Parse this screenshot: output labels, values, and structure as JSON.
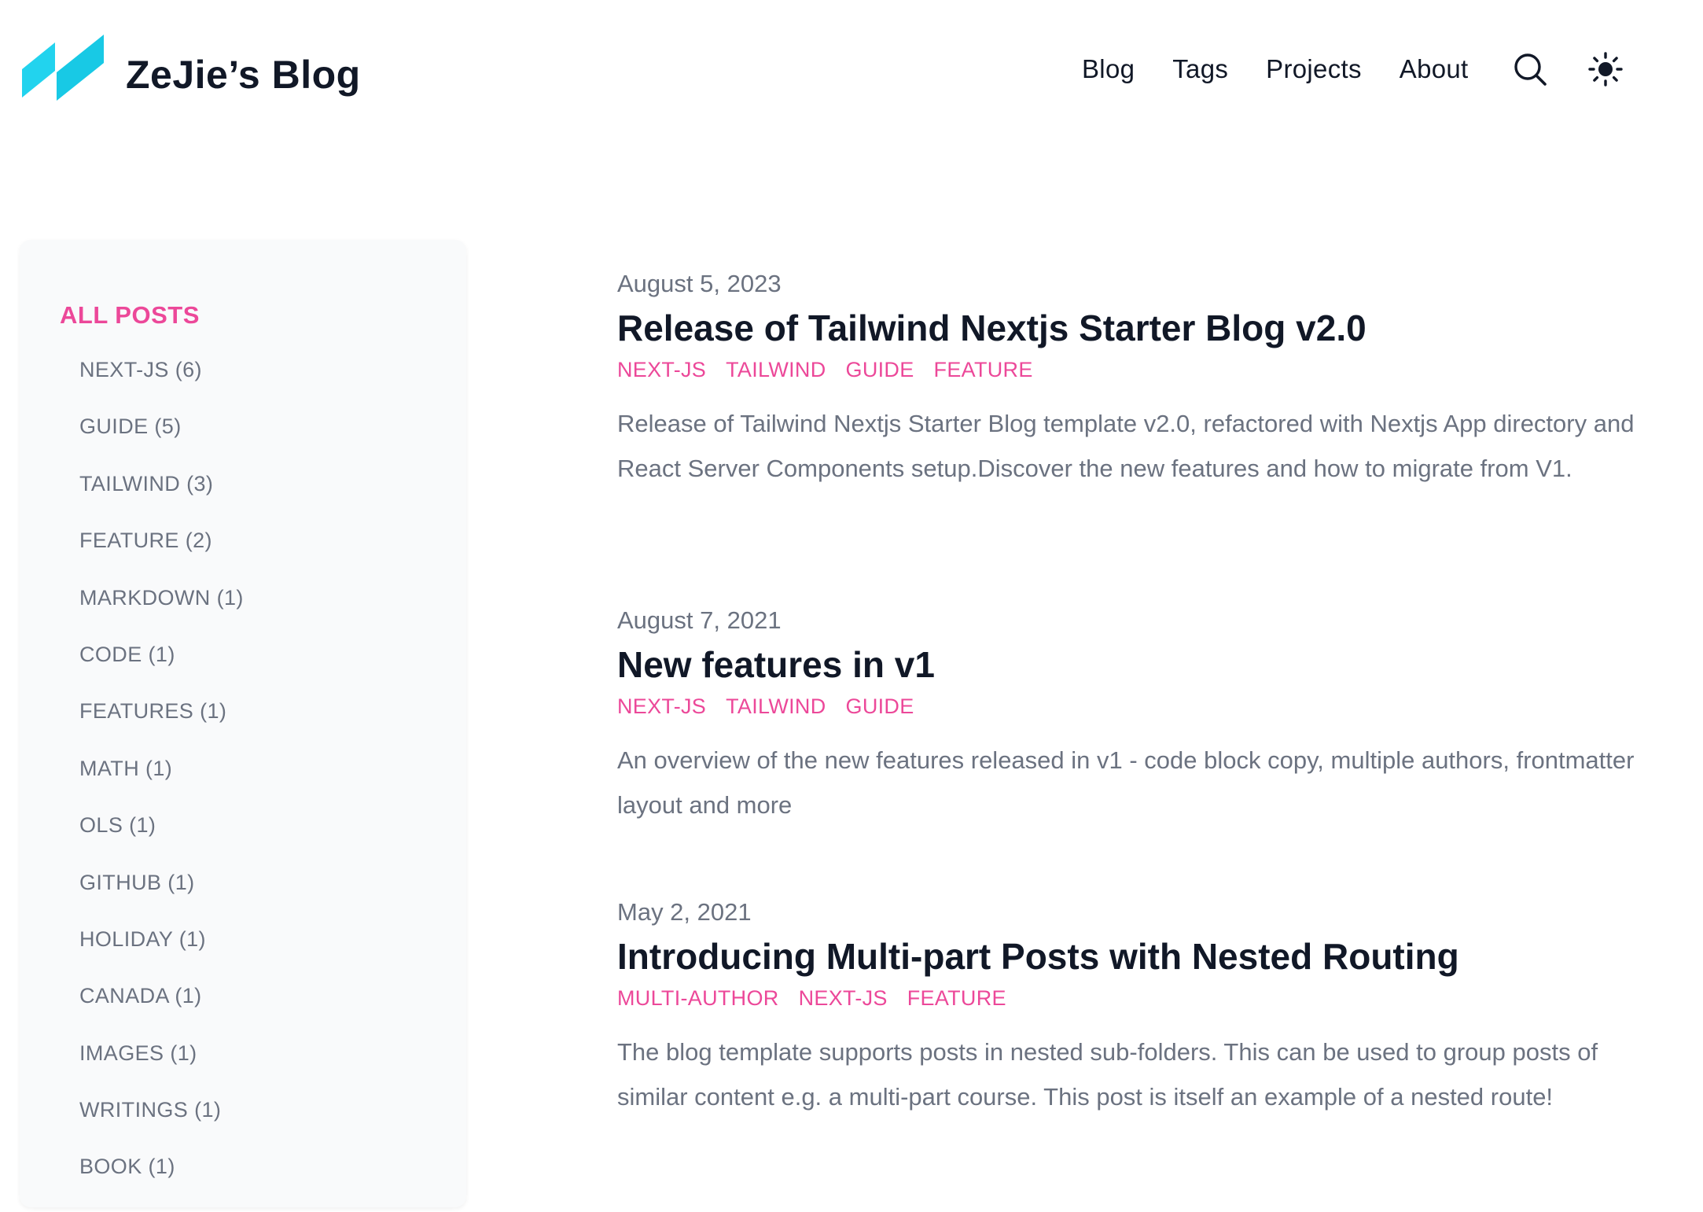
{
  "header": {
    "site_title": "ZeJie’s Blog",
    "nav": [
      "Blog",
      "Tags",
      "Projects",
      "About"
    ],
    "logo_colors": [
      "#22d3ee",
      "#06b6d4"
    ]
  },
  "sidebar": {
    "all_posts_label": "ALL POSTS",
    "tags": [
      "NEXT-JS (6)",
      "GUIDE (5)",
      "TAILWIND (3)",
      "FEATURE (2)",
      "MARKDOWN (1)",
      "CODE (1)",
      "FEATURES (1)",
      "MATH (1)",
      "OLS (1)",
      "GITHUB (1)",
      "HOLIDAY (1)",
      "CANADA (1)",
      "IMAGES (1)",
      "WRITINGS (1)",
      "BOOK (1)"
    ]
  },
  "posts": [
    {
      "date": "August 5, 2023",
      "title": "Release of Tailwind Nextjs Starter Blog v2.0",
      "tags": [
        "NEXT-JS",
        "TAILWIND",
        "GUIDE",
        "FEATURE"
      ],
      "summary": "Release of Tailwind Nextjs Starter Blog template v2.0, refactored with Nextjs App directory and React Server Components setup.Discover the new features and how to migrate from V1."
    },
    {
      "date": "August 7, 2021",
      "title": "New features in v1",
      "tags": [
        "NEXT-JS",
        "TAILWIND",
        "GUIDE"
      ],
      "summary": "An overview of the new features released in v1 - code block copy, multiple authors, frontmatter layout and more"
    },
    {
      "date": "May 2, 2021",
      "title": "Introducing Multi-part Posts with Nested Routing",
      "tags": [
        "MULTI-AUTHOR",
        "NEXT-JS",
        "FEATURE"
      ],
      "summary": "The blog template supports posts in nested sub-folders. This can be used to group posts of similar content e.g. a multi-part course. This post is itself an example of a nested route!"
    }
  ],
  "colors": {
    "accent": "#ec4899",
    "text": "#111827",
    "muted": "#6b7280",
    "sidebar_bg": "#f9fafb"
  }
}
